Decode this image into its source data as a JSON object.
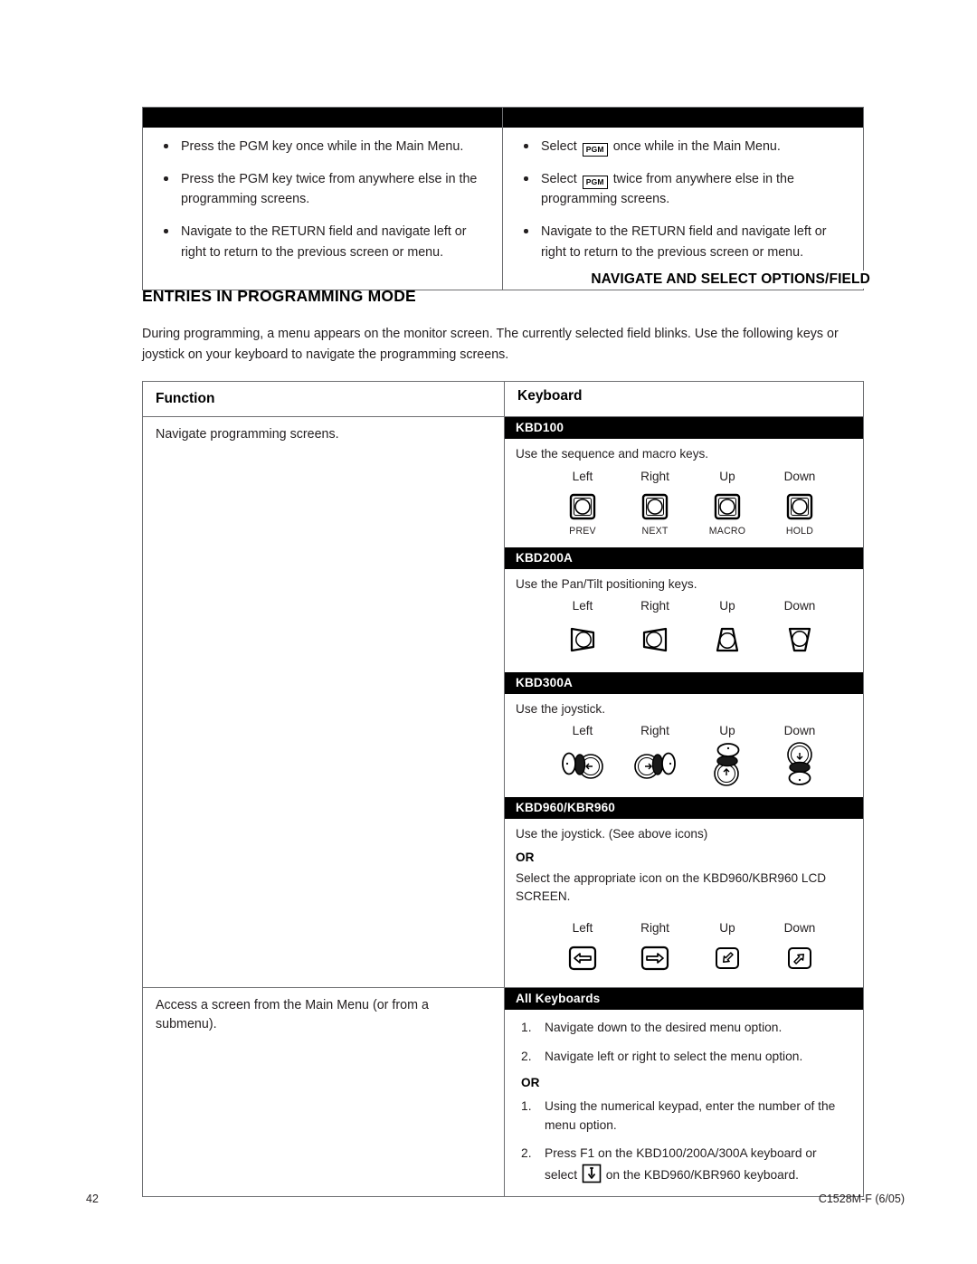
{
  "top_table": {
    "left_column": {
      "bullets": [
        "Press the PGM key once while in the Main Menu.",
        "Press the PGM key twice from anywhere else in the programming screens.",
        "Navigate to the RETURN field and navigate left or right to return to the previous screen or menu."
      ]
    },
    "right_column": {
      "key_label": "PGM",
      "bullet1_before": "Select",
      "bullet1_after": "once while in the Main Menu.",
      "bullet2_before": "Select",
      "bullet2_after": "twice from anywhere else in the programming screens.",
      "bullet3": "Navigate to the RETURN field and navigate left or right to return to the previous screen or menu."
    }
  },
  "running_head": "NAVIGATE AND SELECT OPTIONS/FIELD",
  "section": {
    "heading": "ENTRIES IN PROGRAMMING MODE",
    "intro": "During programming, a menu appears on the monitor screen. The currently selected field blinks. Use the following keys or joystick on your keyboard to navigate the programming screens."
  },
  "main_table": {
    "headers": {
      "function": "Function",
      "keyboard": "Keyboard"
    },
    "row1": {
      "function": "Navigate programming screens.",
      "panels": [
        {
          "title": "KBD100",
          "note": "Use the sequence and macro keys.",
          "directions": [
            "Left",
            "Right",
            "Up",
            "Down"
          ],
          "sublabels": [
            "PREV",
            "NEXT",
            "MACRO",
            "HOLD"
          ],
          "icon_names": [
            "round-button-icon",
            "round-button-icon",
            "round-button-icon",
            "round-button-icon"
          ]
        },
        {
          "title": "KBD200A",
          "note": "Use the Pan/Tilt positioning keys.",
          "directions": [
            "Left",
            "Right",
            "Up",
            "Down"
          ],
          "icon_names": [
            "pan-left-key-icon",
            "pan-right-key-icon",
            "tilt-up-key-icon",
            "tilt-down-key-icon"
          ]
        },
        {
          "title": "KBD300A",
          "note": "Use the joystick.",
          "directions": [
            "Left",
            "Right",
            "Up",
            "Down"
          ],
          "icon_names": [
            "joystick-left-icon",
            "joystick-right-icon",
            "joystick-up-icon",
            "joystick-down-icon"
          ]
        },
        {
          "title": "KBD960/KBR960",
          "note": "Use the joystick. (See above icons)",
          "or": "OR",
          "note2": "Select the appropriate icon on the KBD960/KBR960 LCD SCREEN.",
          "directions": [
            "Left",
            "Right",
            "Up",
            "Down"
          ],
          "icon_names": [
            "lcd-arrow-left-icon",
            "lcd-arrow-right-icon",
            "lcd-arrow-up-icon",
            "lcd-arrow-down-icon"
          ]
        }
      ]
    },
    "row2": {
      "function": "Access a screen from the Main Menu (or from a submenu).",
      "panel": {
        "title": "All Keyboards",
        "steps_a": [
          "Navigate down to the desired menu option.",
          "Navigate left or right to select the menu option."
        ],
        "or": "OR",
        "steps_b_1": "Using the numerical keypad, enter the number of the menu option.",
        "steps_b_2_before": "Press F1 on the KBD100/200A/300A keyboard or select",
        "steps_b_2_after": "on the KBD960/KBR960 keyboard."
      }
    }
  },
  "footer": {
    "page_number": "42",
    "document_id": "C1528M-F (6/05)"
  },
  "colors": {
    "band": "#000000",
    "border": "#6d6e71",
    "text": "#231f20"
  }
}
